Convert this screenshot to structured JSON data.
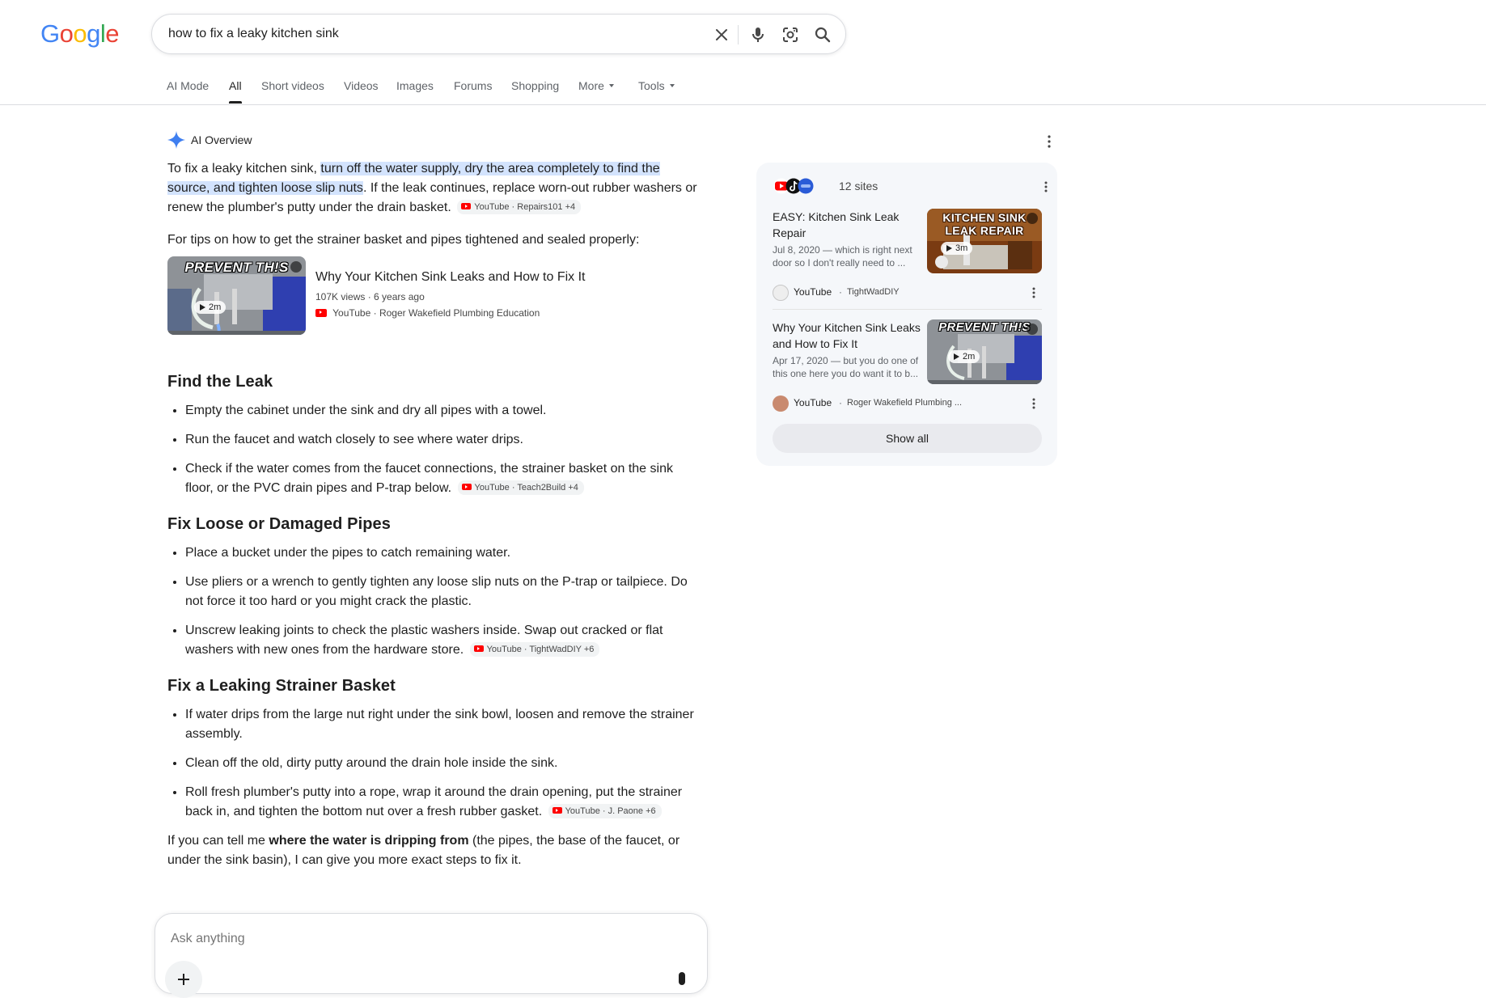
{
  "logo": {
    "letters": [
      "G",
      "o",
      "o",
      "g",
      "l",
      "e"
    ],
    "colors": [
      "#4285F4",
      "#EA4335",
      "#FBBC05",
      "#4285F4",
      "#34A853",
      "#EA4335"
    ]
  },
  "search": {
    "query": "how to fix a leaky kitchen sink"
  },
  "nav": {
    "tabs": [
      "AI Mode",
      "All",
      "Short videos",
      "Videos",
      "Images",
      "Forums",
      "Shopping",
      "More",
      "Tools"
    ],
    "active": "All"
  },
  "ai_overview": {
    "label": "AI Overview",
    "intro": {
      "before": "To fix a leaky kitchen sink, ",
      "highlight": "turn off the water supply, dry the area completely to find the source, and tighten loose slip nuts",
      "after": ". If the leak continues, replace worn-out rubber washers or renew the plumber's putty under the drain basket.",
      "chip": "YouTube · Repairs101 +4"
    },
    "tips_text": "For tips on how to get the strainer basket and pipes tightened and sealed properly:",
    "video": {
      "thumb_caption": "PREVENT TH!S",
      "duration": "2m",
      "title": "Why Your Kitchen Sink Leaks and How to Fix It",
      "meta": "107K views · 6 years ago",
      "source": "YouTube · Roger Wakefield Plumbing Education"
    },
    "sections": [
      {
        "title": "Find the Leak",
        "items": [
          {
            "text": "Empty the cabinet under the sink and dry all pipes with a towel.",
            "chip": ""
          },
          {
            "text": "Run the faucet and watch closely to see where water drips.",
            "chip": ""
          },
          {
            "text": "Check if the water comes from the faucet connections, the strainer basket on the sink floor, or the PVC drain pipes and P-trap below.",
            "chip": "YouTube · Teach2Build +4"
          }
        ]
      },
      {
        "title": "Fix Loose or Damaged Pipes",
        "items": [
          {
            "text": "Place a bucket under the pipes to catch remaining water.",
            "chip": ""
          },
          {
            "text": "Use pliers or a wrench to gently tighten any loose slip nuts on the P-trap or tailpiece. Do not force it too hard or you might crack the plastic.",
            "chip": ""
          },
          {
            "text": "Unscrew leaking joints to check the plastic washers inside. Swap out cracked or flat washers with new ones from the hardware store.",
            "chip": "YouTube · TightWadDIY +6"
          }
        ]
      },
      {
        "title": "Fix a Leaking Strainer Basket",
        "items": [
          {
            "text": "If water drips from the large nut right under the sink bowl, loosen and remove the strainer assembly.",
            "chip": ""
          },
          {
            "text": "Clean off the old, dirty putty around the drain hole inside the sink.",
            "chip": ""
          },
          {
            "text": "Roll fresh plumber's putty into a rope, wrap it around the drain opening, put the strainer back in, and tighten the bottom nut over a fresh rubber gasket.",
            "chip": "YouTube · J. Paone +6"
          }
        ]
      }
    ],
    "closing": {
      "before": "If you can tell me ",
      "bold": "where the water is dripping from",
      "after": " (the pipes, the base of the faucet, or under the sink basin), I can give you more exact steps to fix it."
    },
    "prompt_placeholder": "Ask anything"
  },
  "sites_panel": {
    "count": "12 sites",
    "cards": [
      {
        "title": "EASY: Kitchen Sink Leak Repair",
        "snippet": "Jul 8, 2020 — which is right next door so I don't really need to ...",
        "thumb_caption": "KITCHEN SINK LEAK REPAIR",
        "duration": "3m",
        "source": "YouTube",
        "channel": "TightWadDIY"
      },
      {
        "title": "Why Your Kitchen Sink Leaks and How to Fix It",
        "snippet": "Apr 17, 2020 — but you do one of this one here you do want it to b...",
        "thumb_caption": "PREVENT TH!S",
        "duration": "2m",
        "source": "YouTube",
        "channel": "Roger Wakefield Plumbing ..."
      }
    ],
    "show_all": "Show all"
  }
}
